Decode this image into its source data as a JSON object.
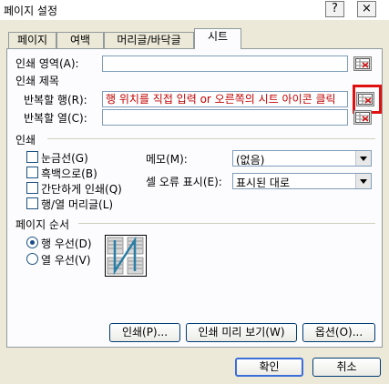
{
  "window": {
    "title": "페이지 설정",
    "help_glyph": "?",
    "close_glyph": "×"
  },
  "tabs": [
    {
      "label": "페이지"
    },
    {
      "label": "여백"
    },
    {
      "label": "머리글/바닥글"
    },
    {
      "label": "시트"
    }
  ],
  "print_area": {
    "label": "인쇄 영역(A):",
    "value": ""
  },
  "print_titles": {
    "heading": "인쇄 제목",
    "rows_label": "반복할 행(R):",
    "rows_value": "행 위치를 직접 입력 or 오른쪽의 시트 아이콘 클릭",
    "cols_label": "반복할 열(C):",
    "cols_value": ""
  },
  "print": {
    "heading": "인쇄",
    "gridlines": "눈금선(G)",
    "black_white": "흑백으로(B)",
    "draft": "간단하게 인쇄(Q)",
    "row_col_headers": "행/열 머리글(L)",
    "comments_label": "메모(M):",
    "comments_value": "(없음)",
    "errors_label": "셀 오류 표시(E):",
    "errors_value": "표시된 대로"
  },
  "page_order": {
    "heading": "페이지 순서",
    "down_then_over": "행 우선(D)",
    "over_then_down": "열 우선(V)"
  },
  "buttons": {
    "print": "인쇄(P)...",
    "preview": "인쇄 미리 보기(W)",
    "options": "옵션(O)...",
    "ok": "확인",
    "cancel": "취소"
  },
  "colors": {
    "highlight_text": "#c00000",
    "highlight_box": "#e01010"
  }
}
